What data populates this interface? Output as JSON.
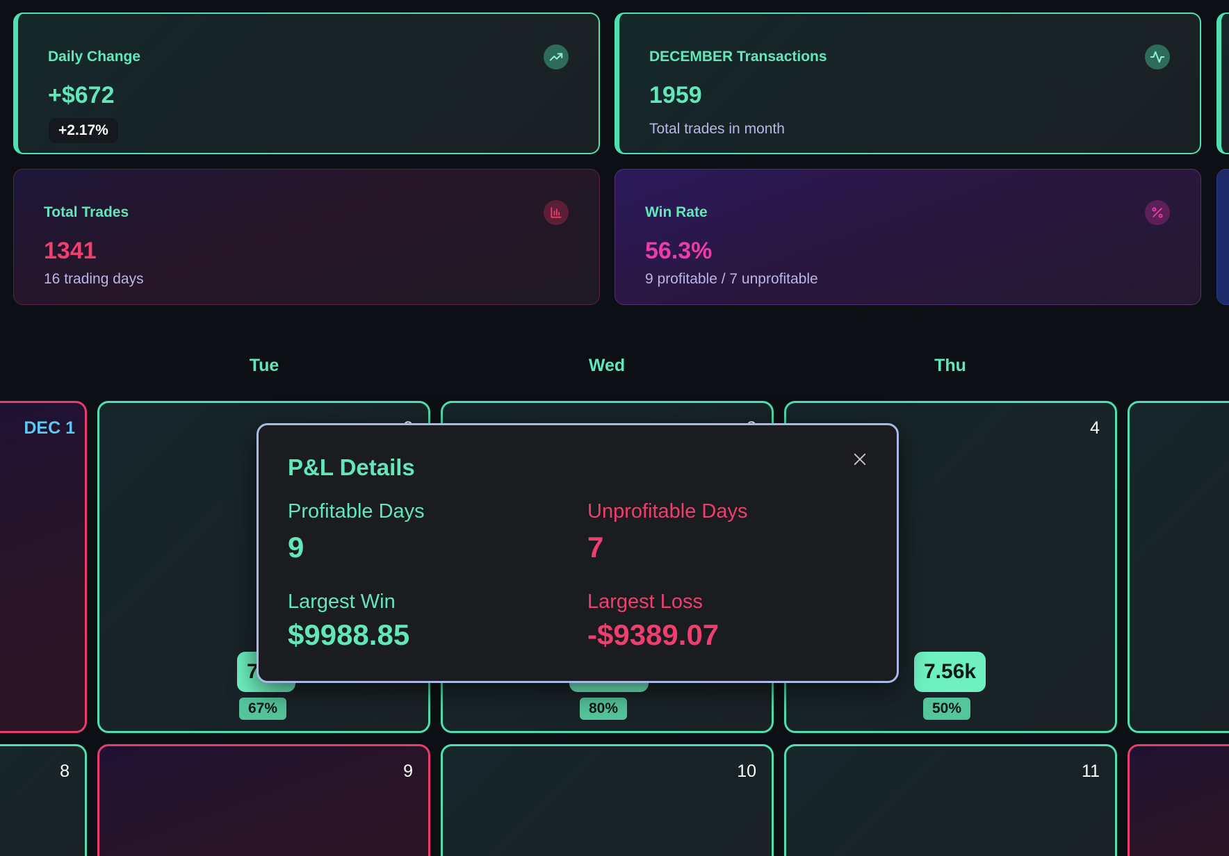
{
  "cards": {
    "daily_change": {
      "label": "Daily Change",
      "value": "+$672",
      "badge": "+2.17%",
      "icon": "trending-up-icon"
    },
    "transactions": {
      "label": "DECEMBER Transactions",
      "value": "1959",
      "sub": "Total trades in month",
      "icon": "activity-icon"
    },
    "total_trades": {
      "label": "Total Trades",
      "value": "1341",
      "sub": "16 trading days",
      "icon": "bar-chart-icon"
    },
    "win_rate": {
      "label": "Win Rate",
      "value": "56.3%",
      "sub": "9 profitable / 7 unprofitable",
      "icon": "percent-icon"
    }
  },
  "calendar": {
    "weekdays": [
      "Tue",
      "Wed",
      "Thu"
    ],
    "days": {
      "d1": "DEC 1",
      "d2": "2",
      "d3": "3",
      "d4": "4",
      "d8": "8",
      "d9": "9",
      "d10": "10",
      "d11": "11"
    },
    "badges": {
      "d2_pnl": "7",
      "d2_pct": "67%",
      "d3_pct": "80%",
      "d4_pnl": "7.56k",
      "d4_pct": "50%"
    }
  },
  "modal": {
    "title": "P&L Details",
    "profitable_days_label": "Profitable Days",
    "profitable_days": "9",
    "unprofitable_days_label": "Unprofitable Days",
    "unprofitable_days": "7",
    "largest_win_label": "Largest Win",
    "largest_win": "$9988.85",
    "largest_loss_label": "Largest Loss",
    "largest_loss": "-$9389.07"
  },
  "colors": {
    "accent_green": "#62e7b8",
    "accent_red": "#ef3f6e",
    "accent_pink": "#ee3ba8",
    "accent_blue": "#5ec8f0"
  }
}
